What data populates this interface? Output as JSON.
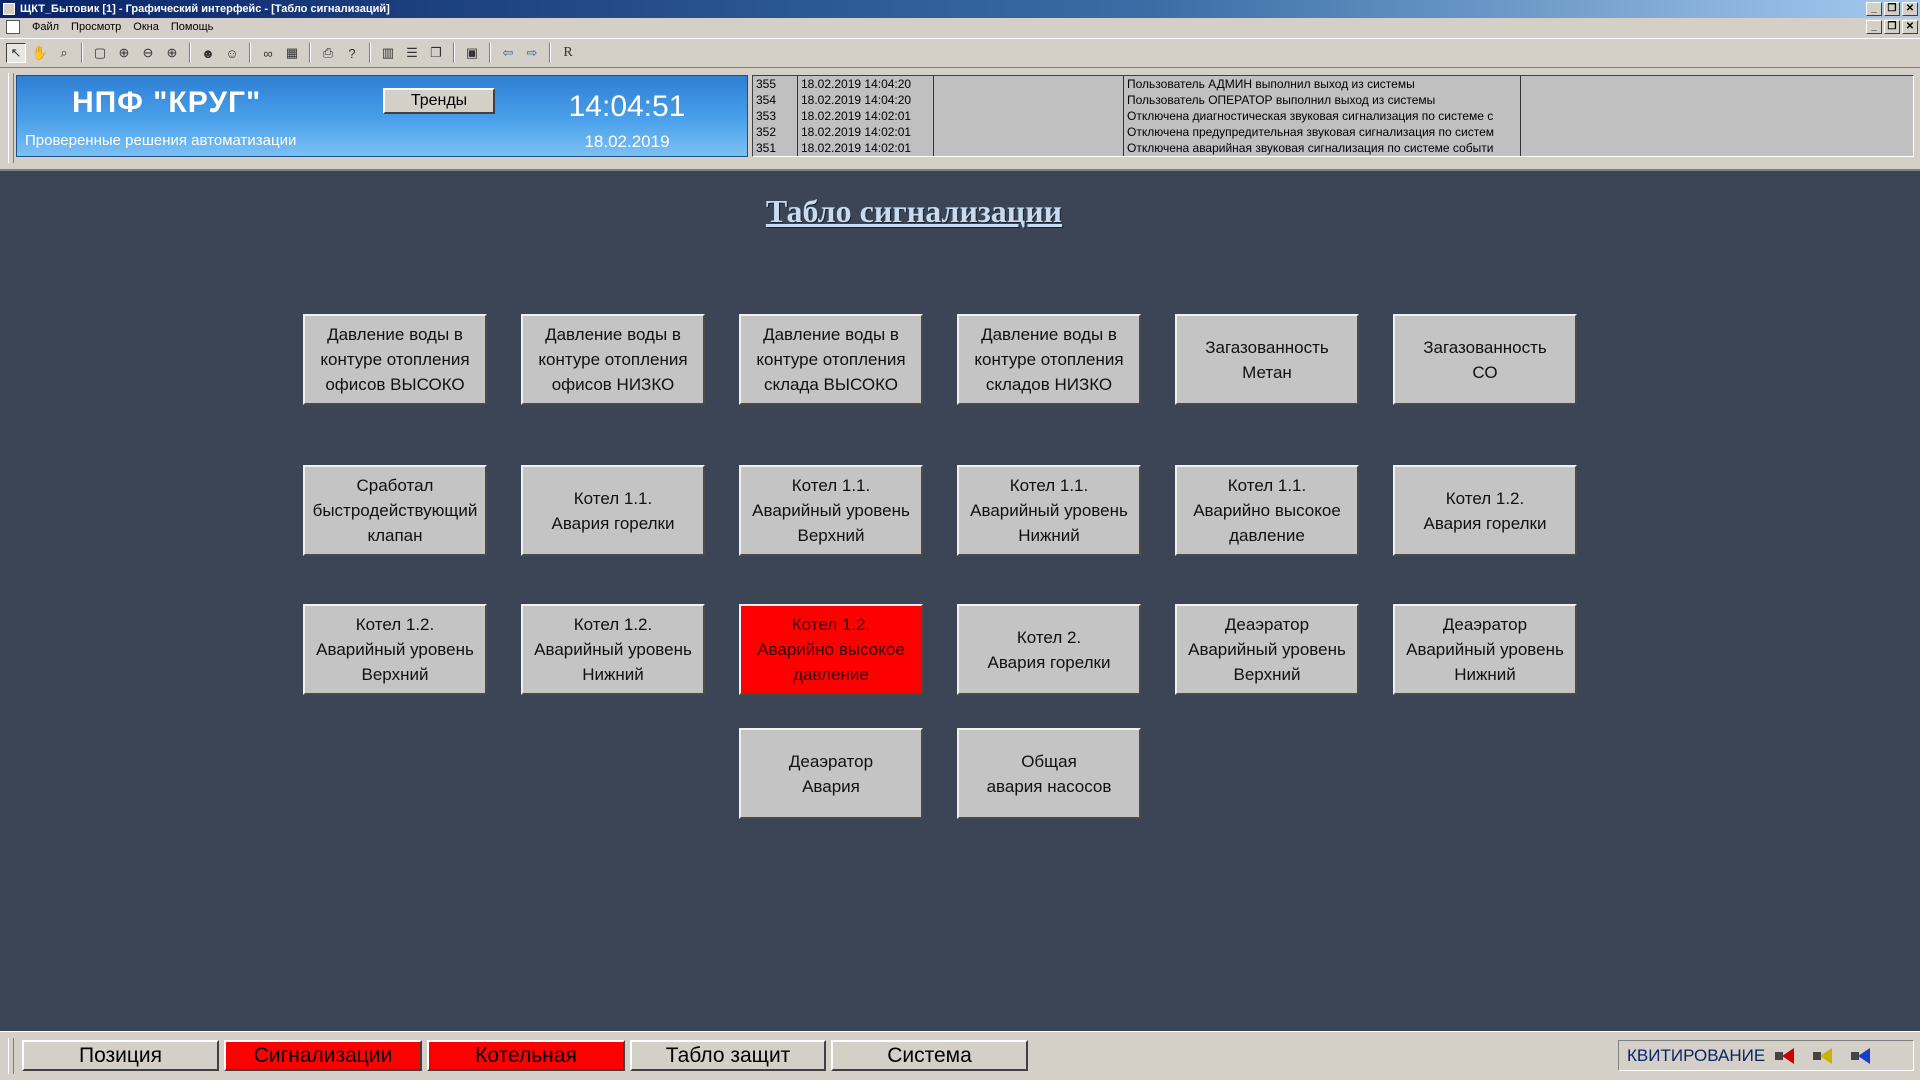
{
  "window": {
    "title": "ЩКТ_Бытовик [1] - Графический интерфейс - [Табло сигнализаций]",
    "controls": {
      "minimize": "_",
      "restore": "❐",
      "close": "✕"
    }
  },
  "menu": {
    "items": [
      "Файл",
      "Просмотр",
      "Окна",
      "Помощь"
    ]
  },
  "toolbar": {
    "r_label": "R"
  },
  "header": {
    "company": "НПФ \"КРУГ\"",
    "slogan": "Проверенные решения автоматизации",
    "trends_label": "Тренды",
    "time": "14:04:51",
    "date": "18.02.2019"
  },
  "events": [
    {
      "id": "355",
      "time": "18.02.2019 14:04:20",
      "message": "Пользователь АДМИН выполнил выход из системы"
    },
    {
      "id": "354",
      "time": "18.02.2019 14:04:20",
      "message": "Пользователь ОПЕРАТОР выполнил выход из системы"
    },
    {
      "id": "353",
      "time": "18.02.2019 14:02:01",
      "message": "Отключена диагностическая звуковая сигнализация по системе с"
    },
    {
      "id": "352",
      "time": "18.02.2019 14:02:01",
      "message": "Отключена предупредительная звуковая сигнализация по систем"
    },
    {
      "id": "351",
      "time": "18.02.2019 14:02:01",
      "message": "Отключена аварийная звуковая сигнализация по системе событи"
    }
  ],
  "page_title": "Табло сигнализации",
  "alarms": [
    {
      "label": "Давление воды в\nконтуре отопления\nофисов ВЫСОКО",
      "active": false
    },
    {
      "label": "Давление воды в\nконтуре отопления\nофисов НИЗКО",
      "active": false
    },
    {
      "label": "Давление воды в\nконтуре отопления\nсклада ВЫСОКО",
      "active": false
    },
    {
      "label": "Давление воды в\nконтуре отопления\nскладов НИЗКО",
      "active": false
    },
    {
      "label": "Загазованность\nМетан",
      "active": false
    },
    {
      "label": "Загазованность\nСО",
      "active": false
    },
    {
      "label": "Сработал\nбыстродействующий\nклапан",
      "active": false
    },
    {
      "label": "Котел 1.1.\nАвария горелки",
      "active": false
    },
    {
      "label": "Котел 1.1.\nАварийный уровень\nВерхний",
      "active": false
    },
    {
      "label": "Котел 1.1.\nАварийный уровень\nНижний",
      "active": false
    },
    {
      "label": "Котел 1.1.\nАварийно высокое\nдавление",
      "active": false
    },
    {
      "label": "Котел 1.2.\nАвария горелки",
      "active": false
    },
    {
      "label": "Котел 1.2.\nАварийный уровень\nВерхний",
      "active": false
    },
    {
      "label": "Котел 1.2.\nАварийный уровень\nНижний",
      "active": false
    },
    {
      "label": "Котел 1.2.\nАварийно высокое\nдавление",
      "active": true
    },
    {
      "label": "Котел 2.\nАвария горелки",
      "active": false
    },
    {
      "label": "Деаэратор\nАварийный уровень\nВерхний",
      "active": false
    },
    {
      "label": "Деаэратор\nАварийный уровень\nНижний",
      "active": false
    },
    {
      "label": "Деаэратор\nАвария",
      "active": false
    },
    {
      "label": "Общая\nавария насосов",
      "active": false
    }
  ],
  "nav": [
    {
      "label": "Позиция",
      "alarm": false
    },
    {
      "label": "Сигнализации",
      "alarm": true
    },
    {
      "label": "Котельная",
      "alarm": true
    },
    {
      "label": "Табло защит",
      "alarm": false
    },
    {
      "label": "Система",
      "alarm": false
    }
  ],
  "ack": {
    "label": "КВИТИРОВАНИЕ",
    "speakers": [
      {
        "name": "alarm-speaker-icon",
        "color": "#cc0000"
      },
      {
        "name": "warning-speaker-icon",
        "color": "#c8b400"
      },
      {
        "name": "diagnostic-speaker-icon",
        "color": "#1a3ccc"
      }
    ]
  },
  "colors": {
    "workspace": "#3b4555",
    "alarm_active": "#ff0000",
    "tile": "#c4c4c4",
    "brand": "#4aa0ea"
  }
}
